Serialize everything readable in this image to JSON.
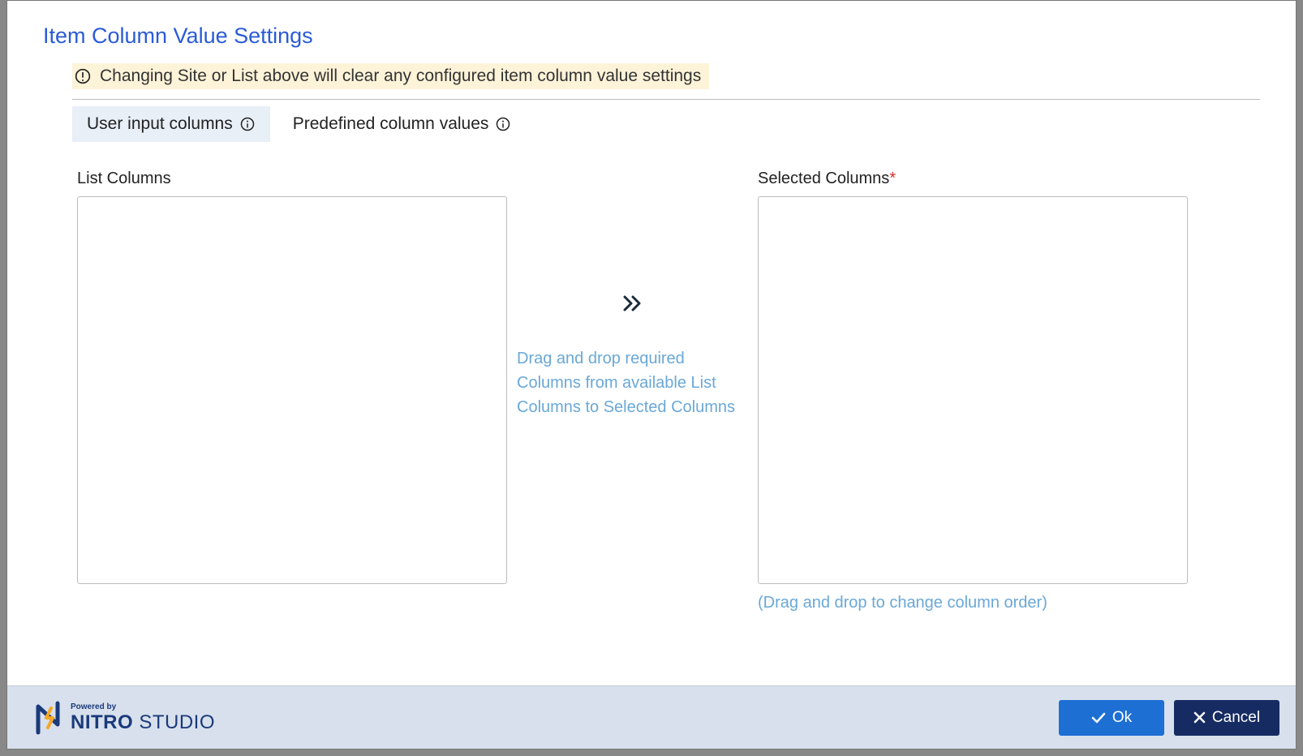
{
  "title": "Item Column Value Settings",
  "warning": "Changing Site or List above will clear any configured item column value settings",
  "tabs": {
    "user_input": "User input columns",
    "predefined": "Predefined column values"
  },
  "labels": {
    "list_columns": "List Columns",
    "selected_columns": "Selected Columns",
    "required_mark": "*"
  },
  "hints": {
    "drag_drop": "Drag and drop required Columns from available List Columns to Selected Columns",
    "reorder": "(Drag and drop to change column order)"
  },
  "footer": {
    "powered_by": "Powered by",
    "brand_bold": "NITRO",
    "brand_light": " STUDIO",
    "ok": "Ok",
    "cancel": "Cancel"
  }
}
